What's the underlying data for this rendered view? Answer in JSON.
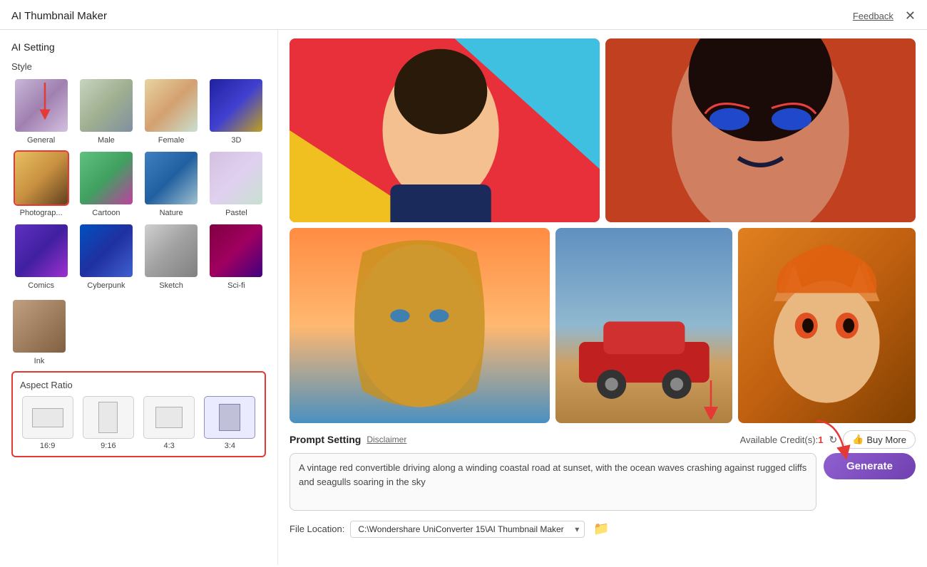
{
  "header": {
    "title": "AI Thumbnail Maker",
    "feedback": "Feedback",
    "close": "✕"
  },
  "left_panel": {
    "section_title": "AI Setting",
    "style_label": "Style",
    "styles": [
      {
        "id": "general",
        "name": "General",
        "selected": false
      },
      {
        "id": "male",
        "name": "Male",
        "selected": false
      },
      {
        "id": "female",
        "name": "Female",
        "selected": false
      },
      {
        "id": "3d",
        "name": "3D",
        "selected": false
      },
      {
        "id": "photo",
        "name": "Photograp...",
        "selected": true
      },
      {
        "id": "cartoon",
        "name": "Cartoon",
        "selected": false
      },
      {
        "id": "nature",
        "name": "Nature",
        "selected": false
      },
      {
        "id": "pastel",
        "name": "Pastel",
        "selected": false
      },
      {
        "id": "comics",
        "name": "Comics",
        "selected": false
      },
      {
        "id": "cyberpunk",
        "name": "Cyberpunk",
        "selected": false
      },
      {
        "id": "sketch",
        "name": "Sketch",
        "selected": false
      },
      {
        "id": "scifi",
        "name": "Sci-fi",
        "selected": false
      },
      {
        "id": "ink",
        "name": "Ink",
        "selected": false
      }
    ],
    "aspect_ratio_label": "Aspect Ratio",
    "aspect_ratios": [
      {
        "id": "16-9",
        "label": "16:9",
        "selected": false
      },
      {
        "id": "9-16",
        "label": "9:16",
        "selected": false
      },
      {
        "id": "4-3",
        "label": "4:3",
        "selected": false
      },
      {
        "id": "3-4",
        "label": "3:4",
        "selected": true
      }
    ]
  },
  "right_panel": {
    "thumbnails": [
      {
        "id": "young-man",
        "alt": "Young man colorful portrait"
      },
      {
        "id": "makeup",
        "alt": "Woman with dramatic makeup"
      },
      {
        "id": "blonde-girl",
        "alt": "Blonde girl at sunset"
      },
      {
        "id": "red-car",
        "alt": "Red convertible at beach"
      },
      {
        "id": "anime-fox",
        "alt": "Anime fox character"
      }
    ]
  },
  "prompt_section": {
    "title": "Prompt Setting",
    "disclaimer": "Disclaimer",
    "credits_label": "Available Credit(s):",
    "credits_value": "1",
    "refresh_icon": "↻",
    "buy_more_label": "Buy More",
    "prompt_text": "A vintage red convertible driving along a winding coastal road at sunset, with the ocean waves crashing against rugged cliffs and seagulls soaring in the sky",
    "generate_label": "Generate"
  },
  "bottom_bar": {
    "file_location_label": "File Location:",
    "file_path": "C:\\Wondershare UniConverter 15\\AI Thumbnail Maker",
    "folder_icon": "📁"
  }
}
